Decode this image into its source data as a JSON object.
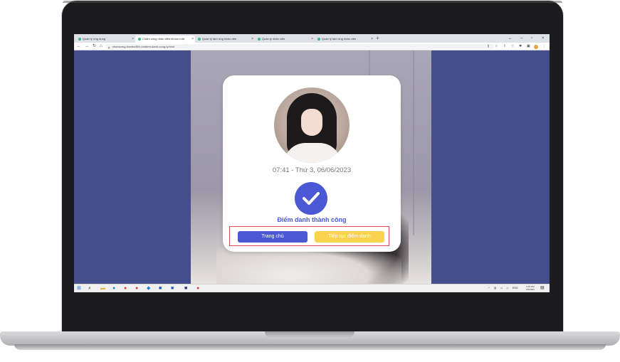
{
  "browser": {
    "tabs": [
      {
        "label": "Quản lý ứng dụng",
        "active": false
      },
      {
        "label": "Chấm công nhận diện khuôn mặt",
        "active": true
      },
      {
        "label": "Quản lý tạm ứng nhân viên",
        "active": false
      },
      {
        "label": "Quản lý nhân viên",
        "active": false
      },
      {
        "label": "Quản lý tạm ứng nhân viên",
        "active": false
      }
    ],
    "url": "chamcong.timviec365.vn/diem-danh-cong-ty.html",
    "accent": "#3dbb8a"
  },
  "card": {
    "datetime": "07:41 - Thứ 3, 06/06/2023",
    "status": "Điểm danh thành công",
    "home_button": "Trang chủ",
    "continue_button": "Tiếp tục điểm danh",
    "primary_color": "#4b58d3",
    "secondary_color": "#f9d34f"
  },
  "taskbar": {
    "language": "ENG",
    "time": "9:01 PM",
    "date": "6/5/2023"
  }
}
